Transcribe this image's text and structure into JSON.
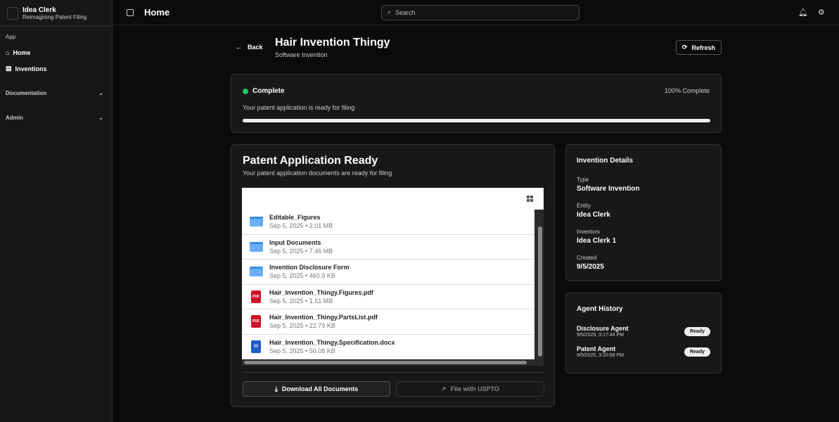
{
  "sidebar": {
    "brand": "Idea Clerk",
    "tagline": "Reimagining Patent Filing",
    "section": "App",
    "items": [
      {
        "label": "Home"
      },
      {
        "label": "Inventions"
      }
    ],
    "groups": [
      {
        "label": "Documentation"
      },
      {
        "label": "Admin"
      }
    ]
  },
  "header": {
    "title": "Home",
    "search_placeholder": "Search"
  },
  "page": {
    "back": "Back",
    "title": "Hair Invention Thingy",
    "subtitle": "Software Invention",
    "refresh": "Refresh"
  },
  "status": {
    "label": "Complete",
    "percent_text": "100% Complete",
    "progress": 100,
    "message": "Your patent application is ready for filing",
    "color": "#22c55e"
  },
  "application": {
    "title": "Patent Application Ready",
    "subtitle": "Your patent application documents are ready for filing",
    "download": "Download All Documents",
    "file": "File with USPTO",
    "files": [
      {
        "name": "Editable_Figures",
        "meta": "Sep 5, 2025 • 2.01 MB",
        "icon": "folder"
      },
      {
        "name": "Input Documents",
        "meta": "Sep 5, 2025 • 7.46 MB",
        "icon": "folder"
      },
      {
        "name": "Invention Disclosure Form",
        "meta": "Sep 5, 2025 • 460.9 KB",
        "icon": "folder"
      },
      {
        "name": "Hair_Invention_Thingy.Figures.pdf",
        "meta": "Sep 5, 2025 • 1.51 MB",
        "icon": "pdf"
      },
      {
        "name": "Hair_Invention_Thingy.PartsList.pdf",
        "meta": "Sep 5, 2025 • 22.79 KB",
        "icon": "pdf"
      },
      {
        "name": "Hair_Invention_Thingy.Specification.docx",
        "meta": "Sep 5, 2025 • 50.08 KB",
        "icon": "docx"
      }
    ]
  },
  "details": {
    "title": "Invention Details",
    "fields": [
      {
        "label": "Type",
        "value": "Software Invention"
      },
      {
        "label": "Entity",
        "value": "Idea Clerk"
      },
      {
        "label": "Inventors",
        "value": "Idea Clerk 1"
      },
      {
        "label": "Created",
        "value": "9/5/2025"
      }
    ]
  },
  "agents": {
    "title": "Agent History",
    "items": [
      {
        "name": "Disclosure Agent",
        "time": "9/5/2025, 3:17:44 PM",
        "status": "Ready"
      },
      {
        "name": "Patent Agent",
        "time": "9/5/2025, 3:20:58 PM",
        "status": "Ready"
      }
    ]
  }
}
